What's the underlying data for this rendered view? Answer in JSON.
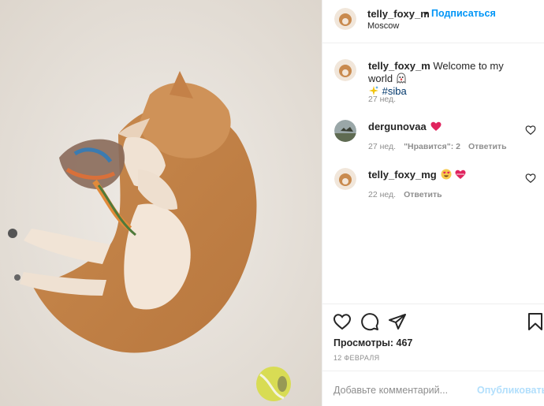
{
  "header": {
    "username": "telly_foxy_m",
    "separator": "•",
    "follow_label": "Подписаться",
    "location": "Moscow"
  },
  "caption": {
    "username": "telly_foxy_m",
    "text": "Welcome to my world",
    "hashtag": "#siba",
    "time": "27 нед."
  },
  "comments": [
    {
      "username": "dergunovaa",
      "text": "",
      "time": "27 нед.",
      "likes": "\"Нравится\": 2",
      "reply_label": "Ответить"
    },
    {
      "username": "telly_foxy_mg",
      "text": "",
      "time": "22 нед.",
      "reply_label": "Ответить"
    }
  ],
  "footer": {
    "views_label": "Просмотры: 467",
    "date": "12 ФЕВРАЛЯ",
    "comment_placeholder": "Добавьте комментарий...",
    "publish_label": "Опубликовать"
  },
  "colors": {
    "accent": "#0095f6",
    "like_red": "#ed4956",
    "muted": "#8e8e8e"
  }
}
